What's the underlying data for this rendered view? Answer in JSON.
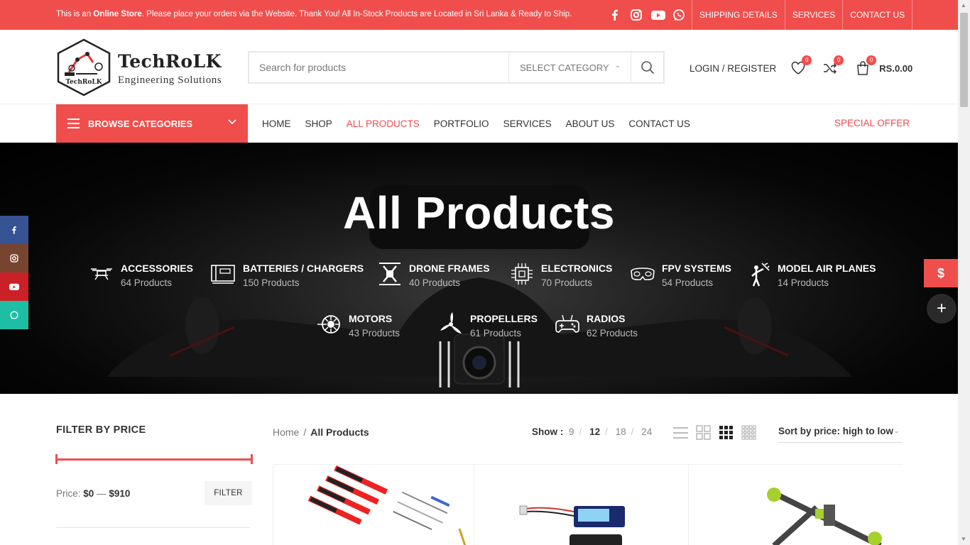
{
  "topbar": {
    "message_pre": "This is an ",
    "message_bold": "Online Store",
    "message_post": ". Please place your orders via the Website. Thank You!  All In-Stock Products are Located in Sri Lanka & Ready to Ship.",
    "social_icons": [
      "facebook-icon",
      "instagram-icon",
      "youtube-icon",
      "whatsapp-icon"
    ],
    "links": [
      "SHIPPING DETAILS",
      "SERVICES",
      "CONTACT US"
    ]
  },
  "header": {
    "brand": "TechRoLK",
    "tagline": "Engineering Solutions",
    "logo_badge": "TechRoLK",
    "search_placeholder": "Search for products",
    "category_select": "SELECT CATEGORY",
    "login": "LOGIN / REGISTER",
    "wishlist_count": "0",
    "compare_count": "0",
    "cart_count": "0",
    "cart_total": "RS.0.00"
  },
  "nav": {
    "browse": "BROWSE CATEGORIES",
    "items": [
      "HOME",
      "SHOP",
      "ALL PRODUCTS",
      "PORTFOLIO",
      "SERVICES",
      "ABOUT US",
      "CONTACT US"
    ],
    "active": "ALL PRODUCTS",
    "special": "SPECIAL OFFER"
  },
  "hero": {
    "title": "All Products",
    "categories": [
      {
        "name": "ACCESSORIES",
        "count": "64 Products",
        "icon": "drone-icon"
      },
      {
        "name": "BATTERIES / CHARGERS",
        "count": "150 Products",
        "icon": "battery-charger-icon"
      },
      {
        "name": "DRONE FRAMES",
        "count": "40 Products",
        "icon": "drone-frame-icon"
      },
      {
        "name": "ELECTRONICS",
        "count": "70 Products",
        "icon": "chip-icon"
      },
      {
        "name": "FPV SYSTEMS",
        "count": "54 Products",
        "icon": "fpv-goggles-icon"
      },
      {
        "name": "MODEL AIR PLANES",
        "count": "14 Products",
        "icon": "model-plane-icon"
      },
      {
        "name": "MOTORS",
        "count": "43 Products",
        "icon": "motor-icon"
      },
      {
        "name": "PROPELLERS",
        "count": "61 Products",
        "icon": "propeller-icon"
      },
      {
        "name": "RADIOS",
        "count": "62 Products",
        "icon": "radio-controller-icon"
      }
    ]
  },
  "floating": {
    "currency": "$",
    "plus": "+"
  },
  "sidebar": {
    "filter_title": "FILTER BY PRICE",
    "price_label": "Price: ",
    "price_min": "$0",
    "price_dash": " — ",
    "price_max": "$910",
    "filter_button": "FILTER"
  },
  "shop": {
    "breadcrumb_home": "Home",
    "breadcrumb_sep": "/",
    "breadcrumb_current": "All Products",
    "show_label": "Show :",
    "show_options": [
      "9",
      "12",
      "18",
      "24"
    ],
    "show_selected": "12",
    "sort": "Sort by price: high to low"
  },
  "colors": {
    "accent": "#f04e4c",
    "dark": "#000000"
  }
}
